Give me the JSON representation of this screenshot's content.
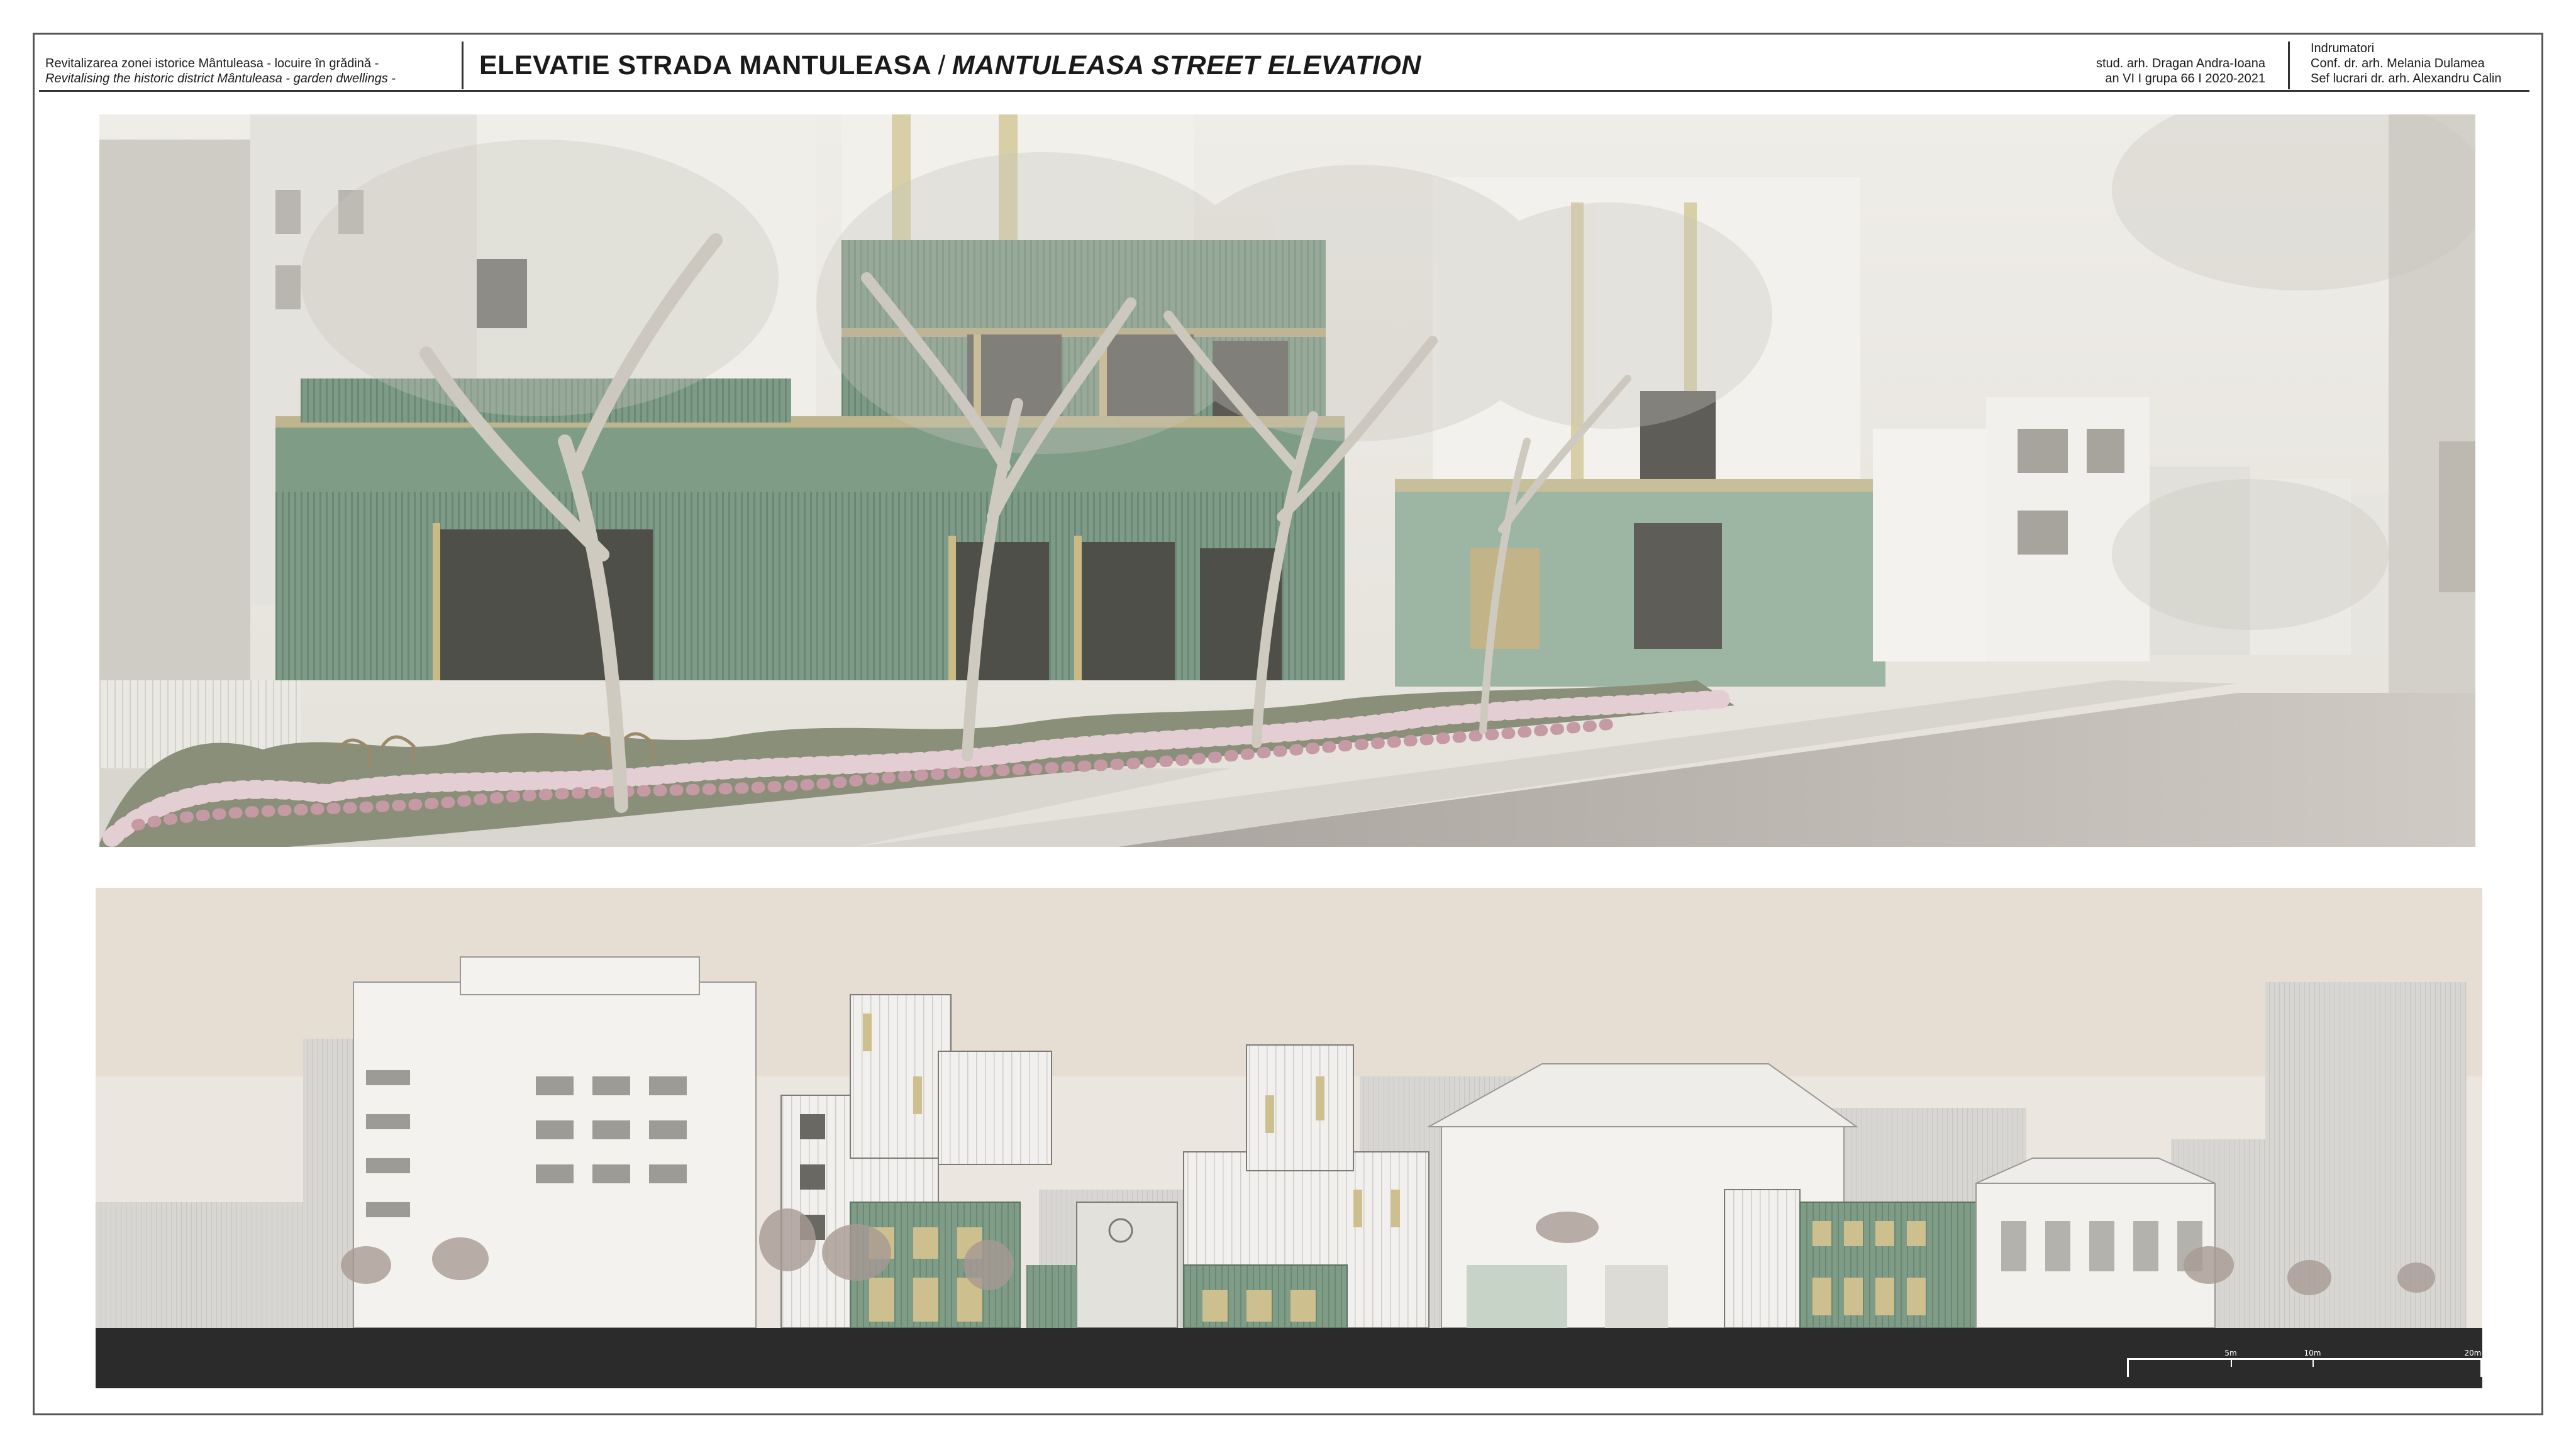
{
  "header": {
    "project_ro": "Revitalizarea zonei istorice Mântuleasa - locuire în grădină -",
    "project_en": "Revitalising the historic district Mântuleasa - garden dwellings -",
    "title_ro": "ELEVATIE STRADA MANTULEASA",
    "title_separator": "/",
    "title_en": "MANTULEASA STREET ELEVATION",
    "student": "stud. arh. Dragan Andra-Ioana",
    "year_group": "an VI  I  grupa 66  I  2020-2021",
    "tutors_label": "Indrumatori",
    "tutors": [
      "Conf. dr. arh. Melania Dulamea",
      "Sef lucrari dr. arh. Alexandru Calin"
    ]
  },
  "scale_bar": {
    "labels": [
      "5m",
      "10m",
      "20m"
    ]
  },
  "colors": {
    "green_facade": "#7f9c87",
    "light_facade": "#eeeeea",
    "sky_render": "#eeece6",
    "sky_elevation": "#e6ddd3",
    "road": "#b9b5ae",
    "ground_band": "#2b2b2b",
    "frame": "#555555"
  }
}
